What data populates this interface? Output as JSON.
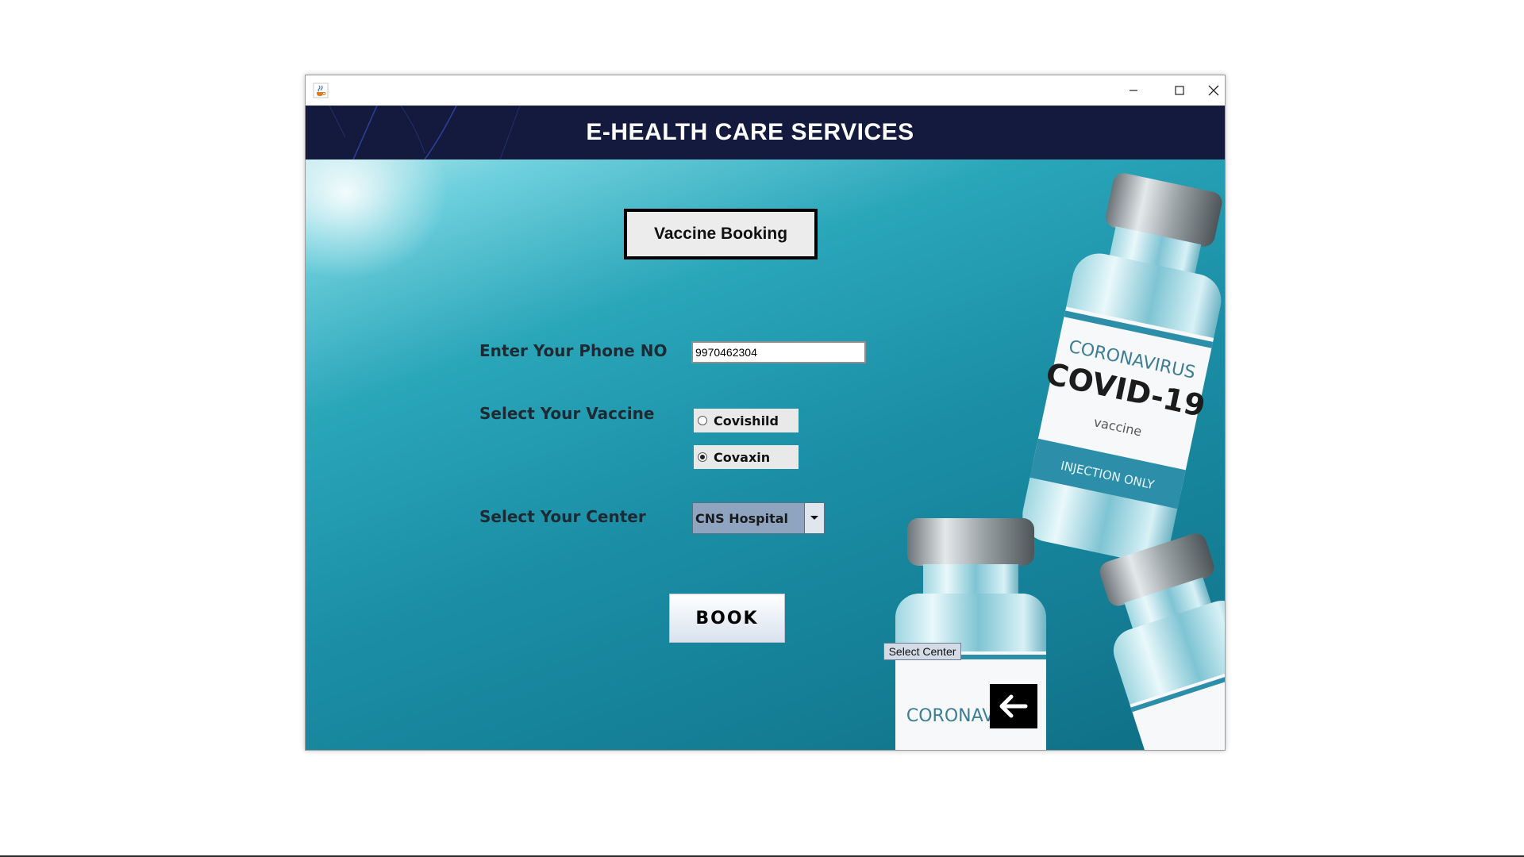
{
  "window": {
    "app_icon": "java-cup-icon",
    "controls": [
      "minimize-icon",
      "maximize-icon",
      "close-icon"
    ]
  },
  "header": {
    "title": "E-HEALTH CARE SERVICES"
  },
  "section": {
    "title": "Vaccine Booking"
  },
  "form": {
    "phone_label": "Enter Your Phone NO",
    "phone_value": "9970462304",
    "vaccine_label": "Select Your Vaccine",
    "vaccine_options": [
      {
        "label": "Covishild",
        "selected": false
      },
      {
        "label": "Covaxin",
        "selected": true
      }
    ],
    "center_label": "Select Your Center",
    "center_selected": "CNS Hospital"
  },
  "actions": {
    "book_label": "BOOK",
    "select_center_label": "Select Center",
    "back_icon": "arrow-left-icon"
  },
  "background": {
    "vial_label_top": "CORONAVIRUS",
    "vial_label_main": "COVID-19",
    "vial_label_sub": "vaccine",
    "vial_label_band": "INJECTION ONLY",
    "vial2_label": "CORONAVIRUS",
    "accent": "#1b8fa6",
    "banner_color": "#141a3e"
  }
}
